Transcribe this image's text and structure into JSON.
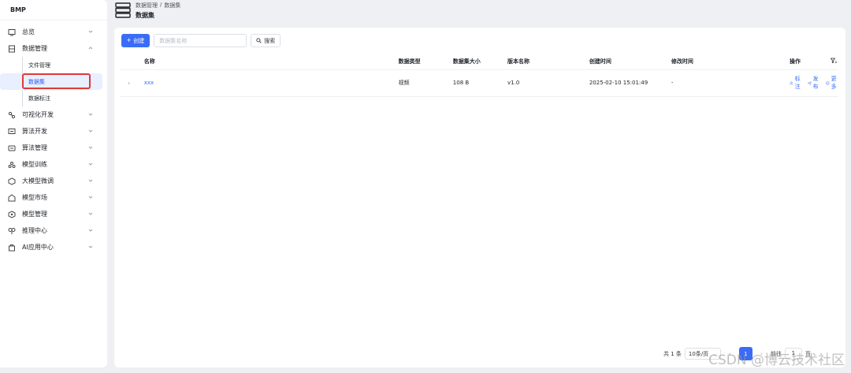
{
  "brand": "BMP",
  "sidebar": {
    "items": [
      {
        "label": "总览",
        "icon": "overview-icon"
      },
      {
        "label": "数据管理",
        "icon": "database-icon",
        "expanded": true,
        "children": [
          "文件管理",
          "数据集",
          "数据标注"
        ],
        "active_child": 1
      },
      {
        "label": "可视化开发",
        "icon": "visual-dev-icon"
      },
      {
        "label": "算法开发",
        "icon": "algorithm-dev-icon"
      },
      {
        "label": "算法管理",
        "icon": "algorithm-mgmt-icon"
      },
      {
        "label": "模型训练",
        "icon": "model-train-icon"
      },
      {
        "label": "大模型微调",
        "icon": "llm-finetune-icon"
      },
      {
        "label": "模型市场",
        "icon": "model-market-icon"
      },
      {
        "label": "模型管理",
        "icon": "model-mgmt-icon"
      },
      {
        "label": "推理中心",
        "icon": "inference-icon"
      },
      {
        "label": "AI应用中心",
        "icon": "ai-app-icon"
      }
    ]
  },
  "header": {
    "breadcrumb": [
      "数据管理",
      "数据集"
    ],
    "separator": "/",
    "title": "数据集"
  },
  "toolbar": {
    "create_label": "创建",
    "search_placeholder": "数据集名称",
    "search_label": "搜索"
  },
  "table": {
    "columns": [
      "名称",
      "数据类型",
      "数据集大小",
      "版本名称",
      "创建时间",
      "修改时间",
      "操作"
    ],
    "rows": [
      {
        "name": "xxx",
        "type": "视频",
        "size": "108 B",
        "version": "v1.0",
        "created": "2025-02-10 15:01:49",
        "modified": "-",
        "actions": [
          "标注",
          "发布",
          "更多"
        ]
      }
    ]
  },
  "pagination": {
    "total_label": "共 1 条",
    "page_size": "10条/页",
    "current_page": "1",
    "jump_label": "前往",
    "jump_value": "1",
    "page_suffix": "页"
  },
  "watermark": "CSDN @博云技术社区",
  "colors": {
    "accent": "#3b6cf5",
    "highlight": "#e03a3a"
  }
}
